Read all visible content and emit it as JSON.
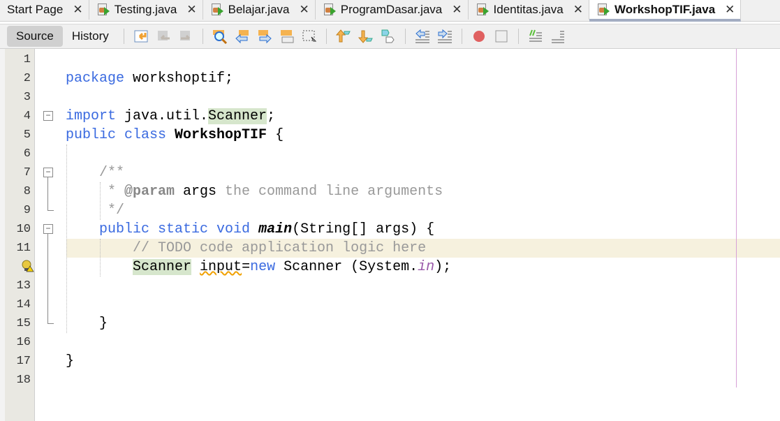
{
  "tabs": [
    {
      "label": "Start Page",
      "icon": "none",
      "active": false
    },
    {
      "label": "Testing.java",
      "icon": "java-file-icon",
      "active": false
    },
    {
      "label": "Belajar.java",
      "icon": "java-file-icon",
      "active": false
    },
    {
      "label": "ProgramDasar.java",
      "icon": "java-file-icon",
      "active": false
    },
    {
      "label": "Identitas.java",
      "icon": "java-file-icon",
      "active": false
    },
    {
      "label": "WorkshopTIF.java",
      "icon": "java-file-icon",
      "active": true
    }
  ],
  "close_glyph": "✕",
  "toolbar": {
    "source": "Source",
    "history": "History"
  },
  "line_numbers": [
    "1",
    "2",
    "3",
    "4",
    "5",
    "6",
    "7",
    "8",
    "9",
    "10",
    "11",
    "",
    "13",
    "14",
    "15",
    "16",
    "17",
    "18"
  ],
  "code": [
    [],
    [
      {
        "t": "package ",
        "c": "kw"
      },
      {
        "t": "workshoptif;"
      }
    ],
    [],
    [
      {
        "t": "import ",
        "c": "kw"
      },
      {
        "t": "java.util."
      },
      {
        "t": "Scanner",
        "c": "sc"
      },
      {
        "t": ";"
      }
    ],
    [
      {
        "t": "public class ",
        "c": "kw"
      },
      {
        "t": "WorkshopTIF",
        "c": "b"
      },
      {
        "t": " {"
      }
    ],
    [],
    [
      {
        "t": "    /**",
        "c": "cm"
      }
    ],
    [
      {
        "t": "     * ",
        "c": "cm"
      },
      {
        "t": "@param",
        "c": "cmb"
      },
      {
        "t": " args "
      },
      {
        "t": "the command line arguments",
        "c": "cm"
      }
    ],
    [
      {
        "t": "     */",
        "c": "cm"
      }
    ],
    [
      {
        "t": "    "
      },
      {
        "t": "public static void ",
        "c": "kw"
      },
      {
        "t": "main",
        "c": "bi"
      },
      {
        "t": "(String[] args) {"
      }
    ],
    [
      {
        "t": "        // TODO code application logic here",
        "c": "cm"
      }
    ],
    [
      {
        "t": "        "
      },
      {
        "t": "Scanner",
        "c": "sc"
      },
      {
        "t": " "
      },
      {
        "t": "input",
        "c": "warn"
      },
      {
        "t": "="
      },
      {
        "t": "new ",
        "c": "kw"
      },
      {
        "t": "Scanner (System."
      },
      {
        "t": "in",
        "c": "it"
      },
      {
        "t": ");"
      }
    ],
    [],
    [],
    [
      {
        "t": "    }"
      }
    ],
    [],
    [
      {
        "t": "}"
      }
    ],
    []
  ],
  "colors": {
    "keyword": "#3a6ae0",
    "comment": "#999999",
    "current_line": "#f6f1de",
    "highlight": "#d6e6cc"
  }
}
